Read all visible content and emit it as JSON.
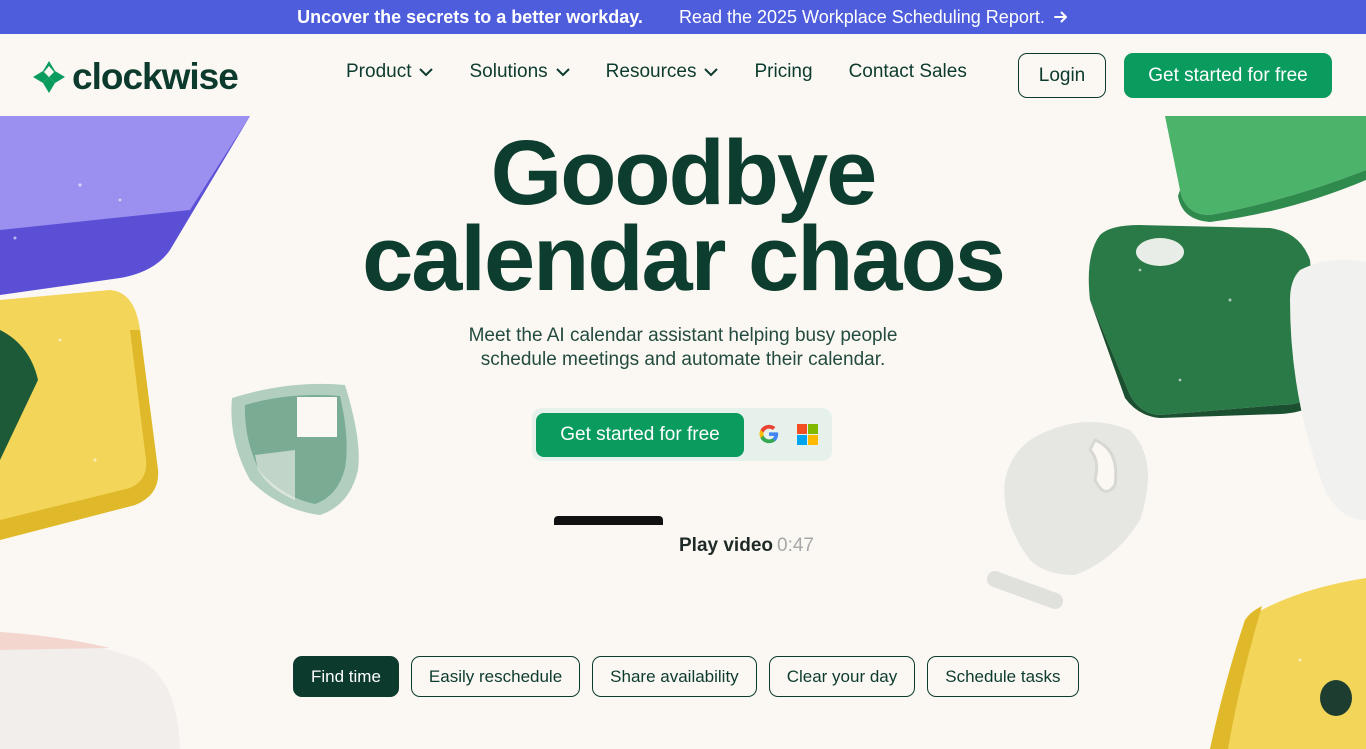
{
  "banner": {
    "headline": "Uncover the secrets to a better workday.",
    "link_text": "Read the 2025 Workplace Scheduling Report.",
    "link_icon": "arrow-right-icon"
  },
  "nav": {
    "logo_text": "clockwise",
    "items": [
      {
        "label": "Product",
        "has_dropdown": true
      },
      {
        "label": "Solutions",
        "has_dropdown": true
      },
      {
        "label": "Resources",
        "has_dropdown": true
      },
      {
        "label": "Pricing",
        "has_dropdown": false
      },
      {
        "label": "Contact Sales",
        "has_dropdown": false
      }
    ],
    "login_label": "Login",
    "cta_label": "Get started for free"
  },
  "hero": {
    "title_line1": "Goodbye",
    "title_line2": "calendar chaos",
    "subtitle_line1": "Meet the AI calendar assistant helping busy people",
    "subtitle_line2": "schedule meetings and automate their calendar.",
    "cta_label": "Get started for free",
    "provider_icons": [
      "google-icon",
      "microsoft-icon"
    ],
    "video_label": "Play video",
    "video_duration": "0:47"
  },
  "tabs": [
    {
      "label": "Find time",
      "active": true
    },
    {
      "label": "Easily reschedule",
      "active": false
    },
    {
      "label": "Share availability",
      "active": false
    },
    {
      "label": "Clear your day",
      "active": false
    },
    {
      "label": "Schedule tasks",
      "active": false
    }
  ],
  "colors": {
    "banner_bg": "#4e5ddc",
    "brand_green": "#0a9b5e",
    "dark_green": "#0c3b2e",
    "page_bg": "#fbf8f4"
  }
}
